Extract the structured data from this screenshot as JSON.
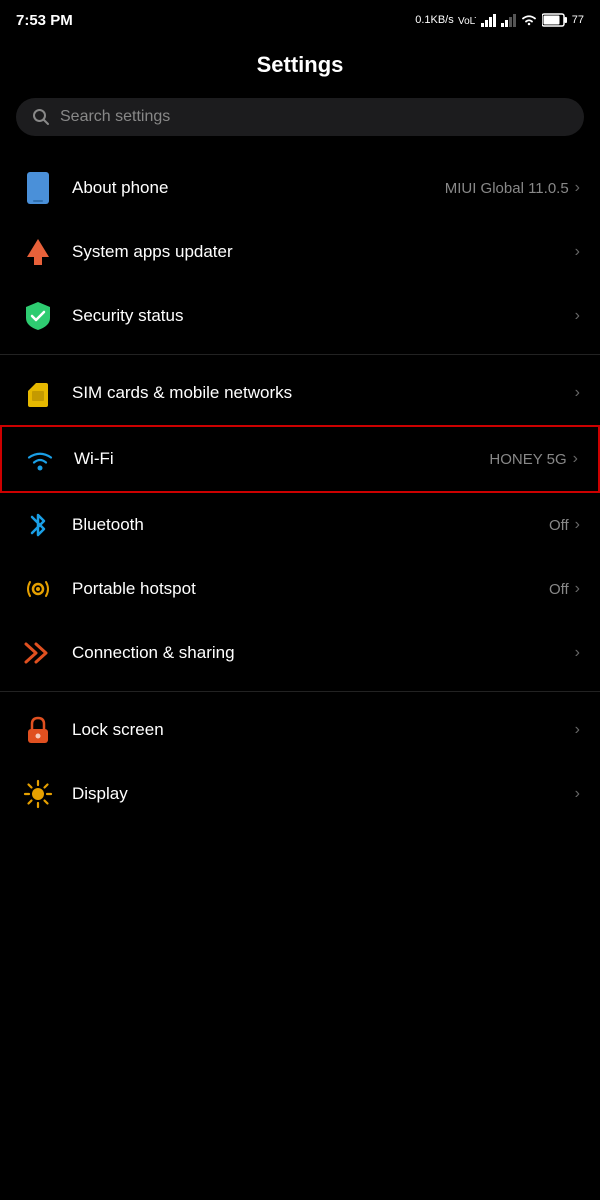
{
  "statusBar": {
    "time": "7:53 PM",
    "network": "0.1KB/s",
    "networkType": "VoLTE",
    "battery": "77",
    "wifiConnected": true
  },
  "header": {
    "title": "Settings"
  },
  "search": {
    "placeholder": "Search settings"
  },
  "sections": [
    {
      "items": [
        {
          "id": "about-phone",
          "label": "About phone",
          "value": "MIUI Global 11.0.5",
          "icon": "phone"
        },
        {
          "id": "system-apps-updater",
          "label": "System apps updater",
          "value": "",
          "icon": "arrow-up"
        },
        {
          "id": "security-status",
          "label": "Security status",
          "value": "",
          "icon": "shield"
        }
      ]
    },
    {
      "items": [
        {
          "id": "sim-cards",
          "label": "SIM cards & mobile networks",
          "value": "",
          "icon": "sim"
        },
        {
          "id": "wifi",
          "label": "Wi-Fi",
          "value": "HONEY 5G",
          "icon": "wifi",
          "highlighted": true
        },
        {
          "id": "bluetooth",
          "label": "Bluetooth",
          "value": "Off",
          "icon": "bluetooth"
        },
        {
          "id": "portable-hotspot",
          "label": "Portable hotspot",
          "value": "Off",
          "icon": "hotspot"
        },
        {
          "id": "connection-sharing",
          "label": "Connection & sharing",
          "value": "",
          "icon": "connection"
        }
      ]
    },
    {
      "items": [
        {
          "id": "lock-screen",
          "label": "Lock screen",
          "value": "",
          "icon": "lock"
        },
        {
          "id": "display",
          "label": "Display",
          "value": "",
          "icon": "display"
        }
      ]
    }
  ],
  "icons": {
    "search": "⌕",
    "chevron": "›"
  }
}
